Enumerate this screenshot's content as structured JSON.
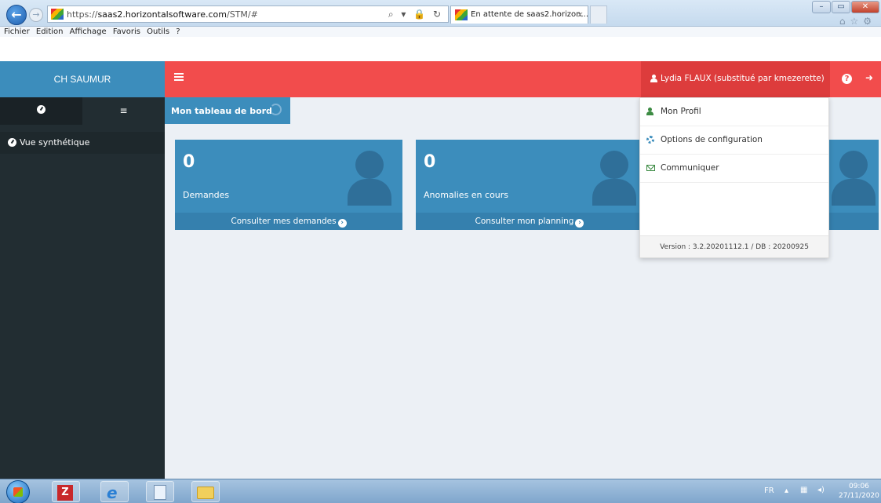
{
  "browser": {
    "url_host": "saas2.horizontalsoftware.com",
    "url_prefix": "https://",
    "url_path": "/STM/#",
    "tab_title": "En attente de saas2.horizon...",
    "tab_close": "×",
    "addr_icons": "⌕ ▾ 🔒 ↻",
    "menu": [
      "Fichier",
      "Edition",
      "Affichage",
      "Favoris",
      "Outils",
      "?"
    ]
  },
  "app": {
    "brand": "CH SAUMUR",
    "user": "Lydia FLAUX (substitué par kmezerette)",
    "help": "?",
    "logout": "➜",
    "sidebar_tab_menu": "≡",
    "sidebar_item": "Vue synthétique",
    "breadcrumb": "Mon tableau de bord"
  },
  "cards": [
    {
      "count": "0",
      "label": "Demandes",
      "link": "Consulter mes demandes"
    },
    {
      "count": "0",
      "label": "Anomalies en cours",
      "link": "Consulter mon planning"
    }
  ],
  "dropdown": {
    "items": [
      "Mon Profil",
      "Options de configuration",
      "Communiquer"
    ],
    "version": "Version : 3.2.20201112.1 / DB : 20200925"
  },
  "taskbar": {
    "lang": "FR",
    "time": "09:06",
    "date": "27/11/2020"
  },
  "colors": {
    "brand_blue": "#3c8dbc",
    "topbar_red": "#f24c4c",
    "sidebar_dark": "#222d32"
  }
}
